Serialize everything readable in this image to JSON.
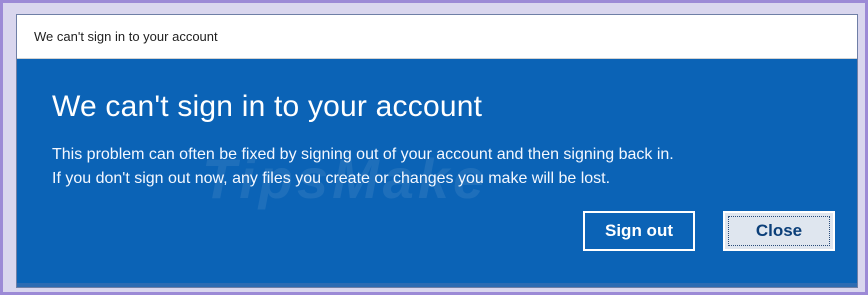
{
  "window": {
    "title": "We can't sign in to your account"
  },
  "dialog": {
    "heading": "We can't sign in to your account",
    "message_line_1": "This problem can often be fixed by signing out of your account and then signing back in.",
    "message_line_2": "If you don't sign out now, any files you create or changes you make will be lost."
  },
  "buttons": {
    "sign_out": "Sign out",
    "close": "Close"
  },
  "watermark": {
    "text": "TipsMake"
  },
  "colors": {
    "dialog_blue": "#0b63b6",
    "close_button": "#dfe6ef",
    "frame_border": "#9c8ad6"
  }
}
